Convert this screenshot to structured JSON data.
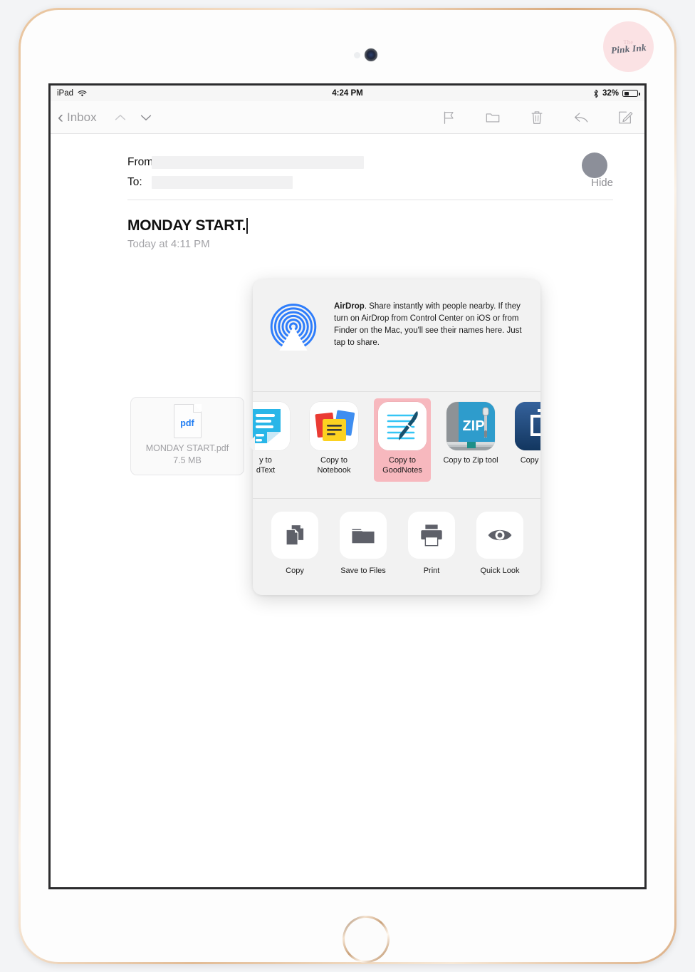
{
  "watermark": {
    "line1": "The",
    "line2": "Pink Ink"
  },
  "status_bar": {
    "device": "iPad",
    "wifi_icon": "wifi-icon",
    "time": "4:24 PM",
    "bluetooth_icon": "bluetooth-icon",
    "battery_percent": "32%",
    "battery_level": 32
  },
  "navbar": {
    "back_label": "Inbox",
    "back_icon": "chevron-left-icon",
    "up_icon": "chevron-up-icon",
    "down_icon": "chevron-down-icon",
    "actions": [
      {
        "name": "flag-icon",
        "label": "Flag"
      },
      {
        "name": "folder-icon",
        "label": "Move to Folder"
      },
      {
        "name": "trash-icon",
        "label": "Delete"
      },
      {
        "name": "reply-icon",
        "label": "Reply"
      },
      {
        "name": "compose-icon",
        "label": "Compose"
      }
    ]
  },
  "message": {
    "from_label": "From:",
    "to_label": "To:",
    "from_value": "",
    "to_value": "",
    "hide_label": "Hide",
    "subject": "MONDAY START.",
    "date": "Today at 4:11 PM"
  },
  "attachment": {
    "type_label": "pdf",
    "filename": "MONDAY START.pdf",
    "filesize": "7.5 MB",
    "accent_color": "#1f7cf2"
  },
  "share_sheet": {
    "airdrop": {
      "title": "AirDrop",
      "body": ". Share instantly with people nearby. If they turn on AirDrop from Control Center on iOS or from Finder on the Mac, you'll see their names here. Just tap to share.",
      "icon": "airdrop-icon",
      "accent_color": "#2e7dfb"
    },
    "apps": [
      {
        "label": "Copy to GoodText",
        "label_line1": "y to",
        "label_line2": "dText",
        "icon": "goodtext-app-icon",
        "selected": false,
        "partial": true
      },
      {
        "label": "Copy to Notebook",
        "label_line1": "Copy to",
        "label_line2": "Notebook",
        "icon": "notebook-app-icon",
        "selected": false,
        "partial": false
      },
      {
        "label": "Copy to GoodNotes",
        "label_line1": "Copy to",
        "label_line2": "GoodNotes",
        "icon": "goodnotes-app-icon",
        "selected": true,
        "partial": false
      },
      {
        "label": "Copy to Zip tool",
        "label_line1": "Copy to Zip tool",
        "label_line2": "",
        "icon": "ziptool-app-icon",
        "selected": false,
        "partial": false
      },
      {
        "label": "Copy to Dr",
        "label_line1": "Copy to Dr",
        "label_line2": "",
        "icon": "documents-app-icon",
        "selected": false,
        "partial": true
      }
    ],
    "selection_color": "#f7b8be",
    "actions": [
      {
        "label": "Copy",
        "icon": "copy-icon"
      },
      {
        "label": "Save to Files",
        "icon": "folder-icon"
      },
      {
        "label": "Print",
        "icon": "printer-icon"
      },
      {
        "label": "Quick Look",
        "icon": "eye-icon"
      }
    ]
  }
}
